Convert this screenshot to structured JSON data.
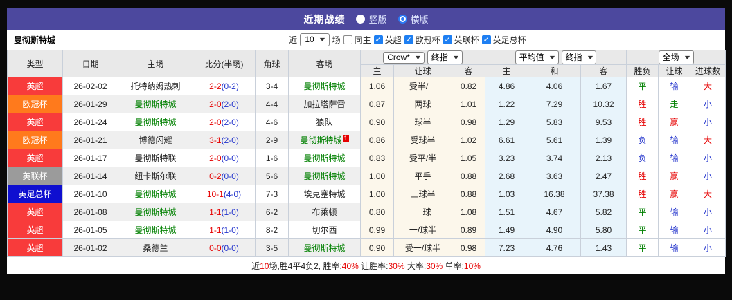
{
  "title_bar": {
    "title": "近期战绩",
    "options": [
      {
        "label": "竖版",
        "selected": false
      },
      {
        "label": "横版",
        "selected": true
      }
    ]
  },
  "filter_bar": {
    "team": "曼彻斯特城",
    "near_label": "近",
    "matches_value": "10",
    "matches_label": "场",
    "same_home_label": "同主",
    "leagues": [
      "英超",
      "欧冠杯",
      "英联杯",
      "英足总杯"
    ]
  },
  "table": {
    "headers_left": [
      "类型",
      "日期",
      "主场",
      "比分(半场)",
      "角球",
      "客场"
    ],
    "dropdowns": {
      "odds_company": "Crow*",
      "odds_time": "终指",
      "europe_type": "平均值",
      "europe_time": "终指",
      "scope": "全场"
    },
    "sub_headers": [
      "主",
      "让球",
      "客",
      "主",
      "和",
      "客",
      "胜负",
      "让球",
      "进球数"
    ],
    "rows": [
      {
        "league": "英超",
        "league_color": "#f83b3b",
        "date": "26-02-02",
        "home": "托特纳姆热刺",
        "home_highlight": false,
        "score_ft": "2-2",
        "score_ht": "(0-2)",
        "corner": "3-4",
        "away": "曼彻斯特城",
        "away_highlight": true,
        "away_card": "",
        "odds_home": "1.06",
        "handicap": "受半/一",
        "odds_away": "0.82",
        "avg_home": "4.86",
        "avg_draw": "4.06",
        "avg_away": "1.67",
        "result_wdl": "平",
        "result_handicap": "输",
        "result_goals": "大"
      },
      {
        "league": "欧冠杯",
        "league_color": "#ff7a1c",
        "date": "26-01-29",
        "home": "曼彻斯特城",
        "home_highlight": true,
        "score_ft": "2-0",
        "score_ht": "(2-0)",
        "corner": "4-4",
        "away": "加拉塔萨雷",
        "away_highlight": false,
        "away_card": "",
        "odds_home": "0.87",
        "handicap": "两球",
        "odds_away": "1.01",
        "avg_home": "1.22",
        "avg_draw": "7.29",
        "avg_away": "10.32",
        "result_wdl": "胜",
        "result_handicap": "走",
        "result_goals": "小"
      },
      {
        "league": "英超",
        "league_color": "#f83b3b",
        "date": "26-01-24",
        "home": "曼彻斯特城",
        "home_highlight": true,
        "score_ft": "2-0",
        "score_ht": "(2-0)",
        "corner": "4-6",
        "away": "狼队",
        "away_highlight": false,
        "away_card": "",
        "odds_home": "0.90",
        "handicap": "球半",
        "odds_away": "0.98",
        "avg_home": "1.29",
        "avg_draw": "5.83",
        "avg_away": "9.53",
        "result_wdl": "胜",
        "result_handicap": "赢",
        "result_goals": "小"
      },
      {
        "league": "欧冠杯",
        "league_color": "#ff7a1c",
        "date": "26-01-21",
        "home": "博德闪耀",
        "home_highlight": false,
        "score_ft": "3-1",
        "score_ht": "(2-0)",
        "corner": "2-9",
        "away": "曼彻斯特城",
        "away_highlight": true,
        "away_card": "1",
        "odds_home": "0.86",
        "handicap": "受球半",
        "odds_away": "1.02",
        "avg_home": "6.61",
        "avg_draw": "5.61",
        "avg_away": "1.39",
        "result_wdl": "负",
        "result_handicap": "输",
        "result_goals": "大"
      },
      {
        "league": "英超",
        "league_color": "#f83b3b",
        "date": "26-01-17",
        "home": "曼彻斯特联",
        "home_highlight": false,
        "score_ft": "2-0",
        "score_ht": "(0-0)",
        "corner": "1-6",
        "away": "曼彻斯特城",
        "away_highlight": true,
        "away_card": "",
        "odds_home": "0.83",
        "handicap": "受平/半",
        "odds_away": "1.05",
        "avg_home": "3.23",
        "avg_draw": "3.74",
        "avg_away": "2.13",
        "result_wdl": "负",
        "result_handicap": "输",
        "result_goals": "小"
      },
      {
        "league": "英联杯",
        "league_color": "#9b9b9b",
        "date": "26-01-14",
        "home": "纽卡斯尔联",
        "home_highlight": false,
        "score_ft": "0-2",
        "score_ht": "(0-0)",
        "corner": "5-6",
        "away": "曼彻斯特城",
        "away_highlight": true,
        "away_card": "",
        "odds_home": "1.00",
        "handicap": "平手",
        "odds_away": "0.88",
        "avg_home": "2.68",
        "avg_draw": "3.63",
        "avg_away": "2.47",
        "result_wdl": "胜",
        "result_handicap": "赢",
        "result_goals": "小"
      },
      {
        "league": "英足总杯",
        "league_color": "#0f0fd0",
        "date": "26-01-10",
        "home": "曼彻斯特城",
        "home_highlight": true,
        "score_ft": "10-1",
        "score_ht": "(4-0)",
        "corner": "7-3",
        "away": "埃克塞特城",
        "away_highlight": false,
        "away_card": "",
        "odds_home": "1.00",
        "handicap": "三球半",
        "odds_away": "0.88",
        "avg_home": "1.03",
        "avg_draw": "16.38",
        "avg_away": "37.38",
        "result_wdl": "胜",
        "result_handicap": "赢",
        "result_goals": "大"
      },
      {
        "league": "英超",
        "league_color": "#f83b3b",
        "date": "26-01-08",
        "home": "曼彻斯特城",
        "home_highlight": true,
        "score_ft": "1-1",
        "score_ht": "(1-0)",
        "corner": "6-2",
        "away": "布莱顿",
        "away_highlight": false,
        "away_card": "",
        "odds_home": "0.80",
        "handicap": "一球",
        "odds_away": "1.08",
        "avg_home": "1.51",
        "avg_draw": "4.67",
        "avg_away": "5.82",
        "result_wdl": "平",
        "result_handicap": "输",
        "result_goals": "小"
      },
      {
        "league": "英超",
        "league_color": "#f83b3b",
        "date": "26-01-05",
        "home": "曼彻斯特城",
        "home_highlight": true,
        "score_ft": "1-1",
        "score_ht": "(1-0)",
        "corner": "8-2",
        "away": "切尔西",
        "away_highlight": false,
        "away_card": "",
        "odds_home": "0.99",
        "handicap": "一/球半",
        "odds_away": "0.89",
        "avg_home": "1.49",
        "avg_draw": "4.90",
        "avg_away": "5.80",
        "result_wdl": "平",
        "result_handicap": "输",
        "result_goals": "小"
      },
      {
        "league": "英超",
        "league_color": "#f83b3b",
        "date": "26-01-02",
        "home": "桑德兰",
        "home_highlight": false,
        "score_ft": "0-0",
        "score_ht": "(0-0)",
        "corner": "3-5",
        "away": "曼彻斯特城",
        "away_highlight": true,
        "away_card": "",
        "odds_home": "0.90",
        "handicap": "受一/球半",
        "odds_away": "0.98",
        "avg_home": "7.23",
        "avg_draw": "4.76",
        "avg_away": "1.43",
        "result_wdl": "平",
        "result_handicap": "输",
        "result_goals": "小"
      }
    ]
  },
  "footer": {
    "segments": [
      {
        "text": "近",
        "red": false
      },
      {
        "text": "10",
        "red": true
      },
      {
        "text": "场,胜4平4负2, 胜率:",
        "red": false
      },
      {
        "text": "40%",
        "red": true
      },
      {
        "text": " 让胜率:",
        "red": false
      },
      {
        "text": "30%",
        "red": true
      },
      {
        "text": " 大率:",
        "red": false
      },
      {
        "text": "30%",
        "red": true
      },
      {
        "text": " 单率:",
        "red": false
      },
      {
        "text": "10%",
        "red": true
      }
    ]
  },
  "colors": {
    "accent_purple": "#4c489e",
    "team_highlight": "#008000",
    "score_ft": "#e60000",
    "score_ht": "#2233cc",
    "results": {
      "胜": "#e60000",
      "平": "#008000",
      "负": "#2233cc",
      "赢": "#e60000",
      "走": "#008000",
      "输": "#2233cc",
      "大": "#e60000",
      "小": "#2233cc"
    }
  }
}
